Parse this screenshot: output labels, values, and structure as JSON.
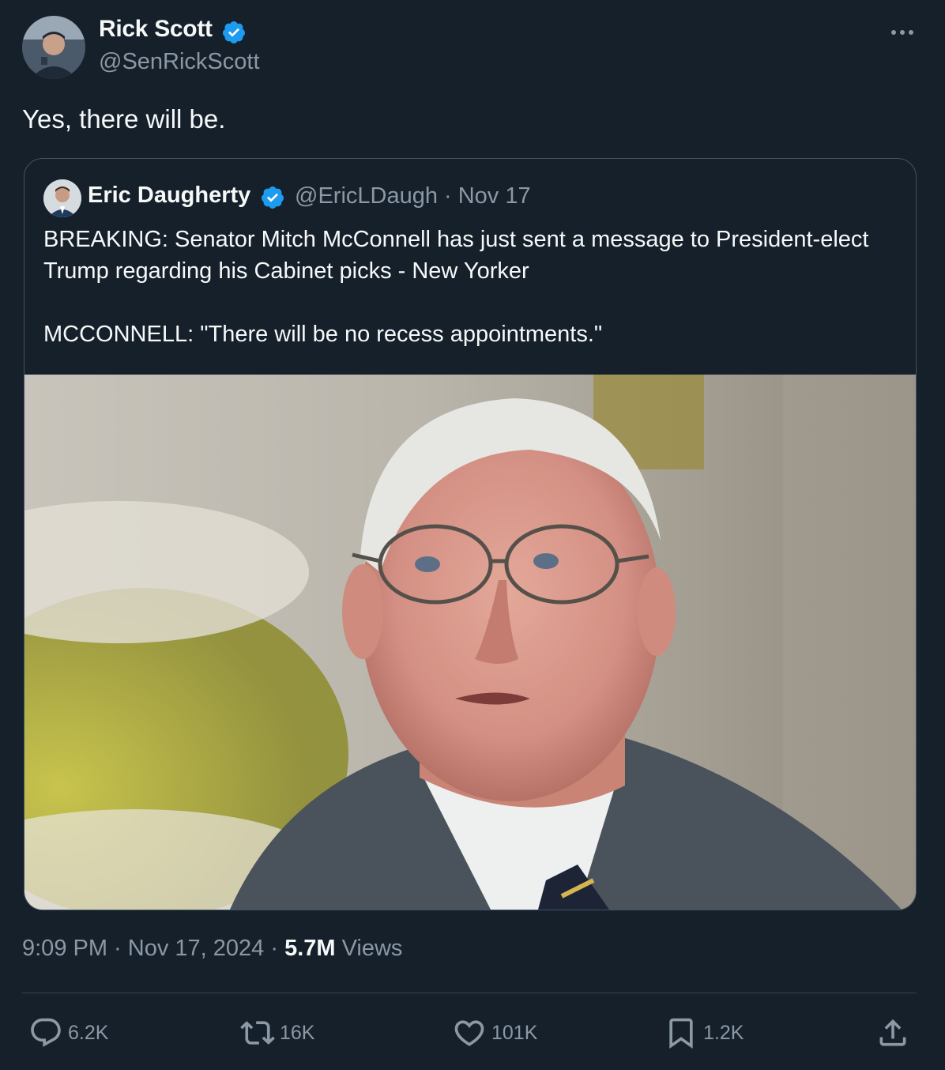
{
  "tweet": {
    "author_name": "Rick Scott",
    "author_handle": "@SenRickScott",
    "text": "Yes, there will be.",
    "timestamp": "9:09 PM · Nov 17, 2024 · ",
    "views_count": "5.7M",
    "views_label": " Views"
  },
  "quoted": {
    "author_name": "Eric Daugherty",
    "handle_line": "@EricLDaugh · Nov 17",
    "text": "BREAKING: Senator Mitch McConnell has just sent a message to President-elect Trump regarding his Cabinet picks - New Yorker\n\nMCCONNELL: \"There will be no recess appointments.\""
  },
  "actions": {
    "replies": "6.2K",
    "reposts": "16K",
    "likes": "101K",
    "bookmarks": "1.2K"
  },
  "icons": {
    "verified": "verified-badge-icon",
    "more": "more-icon",
    "reply": "reply-icon",
    "repost": "repost-icon",
    "like": "heart-icon",
    "bookmark": "bookmark-icon",
    "share": "share-icon"
  },
  "colors": {
    "background": "#15202b",
    "verified": "#1d9bf0",
    "secondary_text": "#8b98a5"
  }
}
